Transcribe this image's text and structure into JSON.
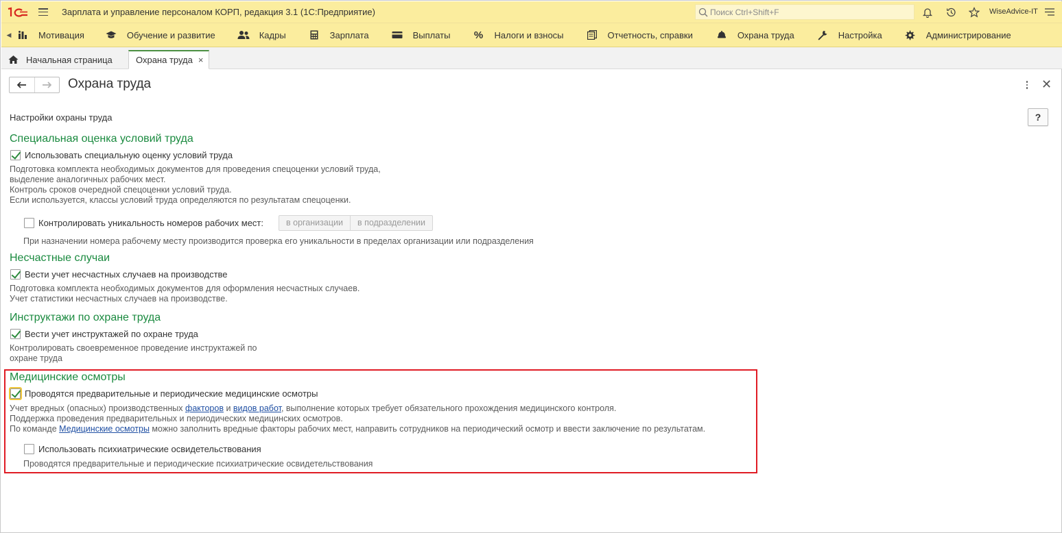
{
  "app": {
    "title": "Зарплата и управление персоналом КОРП, редакция 3.1  (1С:Предприятие)",
    "search_placeholder": "Поиск Ctrl+Shift+F",
    "user": "WiseAdvice-IT"
  },
  "sections": [
    {
      "label": "Мотивация",
      "icon": "motivation-icon"
    },
    {
      "label": "Обучение и развитие",
      "icon": "graduation-cap-icon"
    },
    {
      "label": "Кадры",
      "icon": "people-icon"
    },
    {
      "label": "Зарплата",
      "icon": "calculator-icon"
    },
    {
      "label": "Выплаты",
      "icon": "wallet-icon"
    },
    {
      "label": "Налоги и взносы",
      "icon": "percent-icon"
    },
    {
      "label": "Отчетность, справки",
      "icon": "reports-icon"
    },
    {
      "label": "Охрана труда",
      "icon": "helmet-icon"
    },
    {
      "label": "Настройка",
      "icon": "wrench-icon"
    },
    {
      "label": "Администрирование",
      "icon": "gear-icon"
    }
  ],
  "tabs": {
    "home": "Начальная страница",
    "active": "Охрана труда",
    "close": "×"
  },
  "form": {
    "title": "Охрана труда",
    "subtitle": "Настройки охраны труда",
    "help": "?"
  },
  "sout": {
    "title": "Специальная оценка условий труда",
    "checkbox": "Использовать специальную оценку условий труда",
    "checked": true,
    "desc": [
      "Подготовка комплекта необходимых документов для проведения спецоценки условий труда,",
      "выделение аналогичных рабочих мест.",
      "Контроль сроков очередной спецоценки условий труда.",
      "Если используется, классы условий труда определяются по результатам спецоценки."
    ],
    "unique_checkbox": "Контролировать уникальность номеров рабочих мест:",
    "unique_checked": false,
    "seg_org": "в организации",
    "seg_dept": "в подразделении",
    "unique_desc": "При назначении номера рабочему месту производится проверка его уникальности в пределах организации или подразделения"
  },
  "accidents": {
    "title": "Несчастные случаи",
    "checkbox": "Вести учет несчастных случаев на производстве",
    "checked": true,
    "desc": [
      "Подготовка комплекта необходимых документов для оформления несчастных случаев.",
      "Учет статистики несчастных случаев на производстве."
    ]
  },
  "briefings": {
    "title": "Инструктажи по охране труда",
    "checkbox": "Вести учет инструктажей по охране труда",
    "checked": true,
    "desc": [
      "Контролировать своевременное проведение инструктажей по",
      "охране труда"
    ]
  },
  "medical": {
    "title": "Медицинские осмотры",
    "checkbox": "Проводятся предварительные и периодические медицинские осмотры",
    "checked": true,
    "desc1_a": "Учет вредных (опасных) производственных ",
    "desc1_link1": "факторов",
    "desc1_b": " и ",
    "desc1_link2": "видов работ",
    "desc1_c": ", выполнение которых требует обязательного прохождения медицинского контроля.",
    "desc2": "Поддержка проведения предварительных и периодических медицинских осмотров.",
    "desc3_a": "По команде ",
    "desc3_link": "Медицинские осмотры",
    "desc3_b": " можно заполнить вредные факторы рабочих мест, направить сотрудников на периодический осмотр и ввести заключение по результатам.",
    "psych_checkbox": "Использовать психиатрические освидетельствования",
    "psych_checked": false,
    "psych_desc": "Проводятся предварительные и периодические психиатрические освидетельствования"
  },
  "colors": {
    "header_bg": "#fbed9e",
    "group_title": "#1a8a3f",
    "link": "#1f4fa3",
    "highlight": "#e01b24",
    "check": "#2c8a3c"
  }
}
